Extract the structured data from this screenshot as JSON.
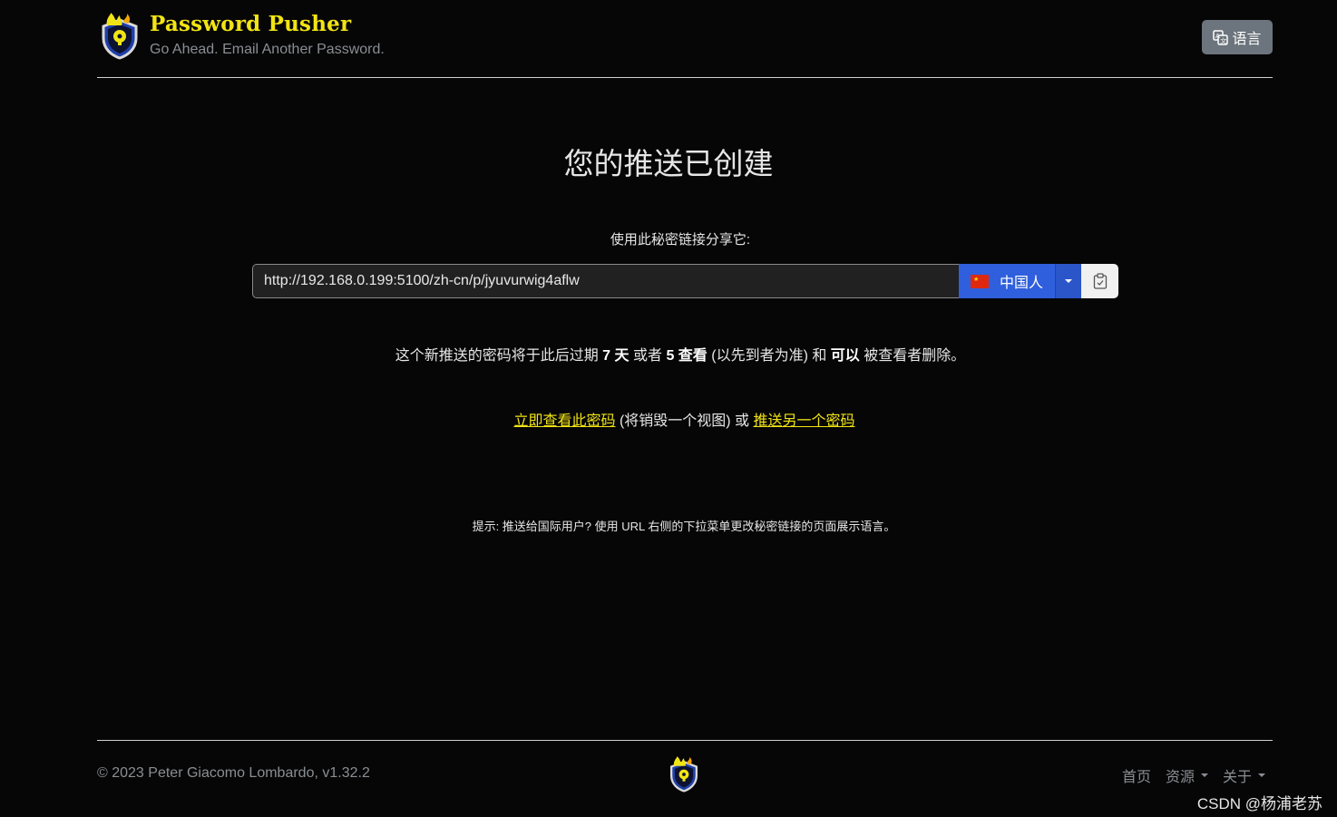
{
  "header": {
    "brand_title": "Password Pusher",
    "brand_tagline": "Go Ahead. Email Another Password.",
    "language_button_label": "语言"
  },
  "main": {
    "title": "您的推送已创建",
    "share_label": "使用此秘密链接分享它:",
    "secret_url": "http://192.168.0.199:5100/zh-cn/p/jyuvurwig4aflw",
    "language_select_label": "中国人",
    "expire": {
      "prefix": "这个新推送的密码将于此后过期 ",
      "days": "7 天",
      "middle": " 或者 ",
      "views": "5 查看",
      "suffix1": " (以先到者为准) 和 ",
      "can": "可以",
      "suffix2": " 被查看者删除。"
    },
    "actions": {
      "view_now_link": "立即查看此密码",
      "middle_text": " (将销毁一个视图) 或 ",
      "push_another_link": "推送另一个密码"
    },
    "hint": "提示: 推送给国际用户? 使用 URL 右侧的下拉菜单更改秘密链接的页面展示语言。"
  },
  "footer": {
    "copyright": "© 2023 Peter Giacomo Lombardo, v1.32.2",
    "nav": {
      "home": "首页",
      "resources": "资源",
      "about": "关于"
    }
  },
  "watermark": "CSDN @杨浦老苏",
  "colors": {
    "background": "#060606",
    "brand_yellow": "#f1e414",
    "primary_blue": "#2f5fdc",
    "secondary_gray": "#6c757d"
  },
  "icons": {
    "logo": "shield-lock-flame-icon",
    "language": "translate-icon",
    "copy": "clipboard-check-icon",
    "flag": "china-flag-icon"
  }
}
